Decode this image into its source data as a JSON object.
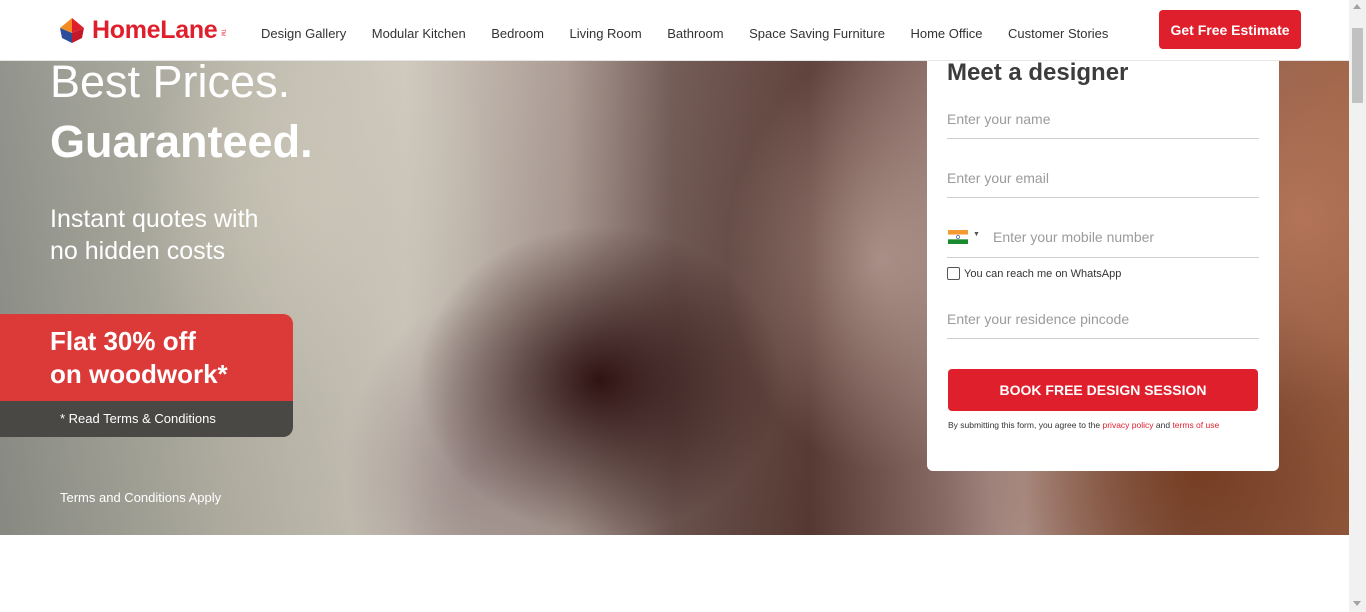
{
  "header": {
    "logo_text": "HomeLane",
    "logo_tm": "TM",
    "nav": [
      {
        "label": "Design Gallery"
      },
      {
        "label": "Modular Kitchen"
      },
      {
        "label": "Bedroom"
      },
      {
        "label": "Living Room"
      },
      {
        "label": "Bathroom"
      },
      {
        "label": "Space Saving Furniture"
      },
      {
        "label": "Home Office"
      },
      {
        "label": "Customer Stories"
      }
    ],
    "cta_label": "Get Free Estimate"
  },
  "hero": {
    "headline_line1": "Best Prices.",
    "headline_line2": "Guaranteed.",
    "sub_line1": "Instant quotes with",
    "sub_line2": "no hidden costs",
    "offer_line1": "Flat 30% off",
    "offer_line2": "on woodwork*",
    "offer_terms": "* Read Terms & Conditions",
    "terms_apply": "Terms and Conditions Apply"
  },
  "form": {
    "title": "Meet a designer",
    "name_placeholder": "Enter your name",
    "email_placeholder": "Enter your email",
    "phone_placeholder": "Enter your mobile number",
    "country_flag": "india-flag-icon",
    "whatsapp_label": "You can reach me on WhatsApp",
    "pincode_placeholder": "Enter your residence pincode",
    "submit_label": "BOOK FREE DESIGN SESSION",
    "disclaimer_prefix": "By submitting this form, you agree to the ",
    "privacy_link": "privacy policy",
    "disclaimer_and": " and ",
    "terms_link": "terms of use"
  },
  "colors": {
    "brand_red": "#e01f2d",
    "offer_red": "#dc3a38",
    "offer_dark": "#4a4845"
  }
}
